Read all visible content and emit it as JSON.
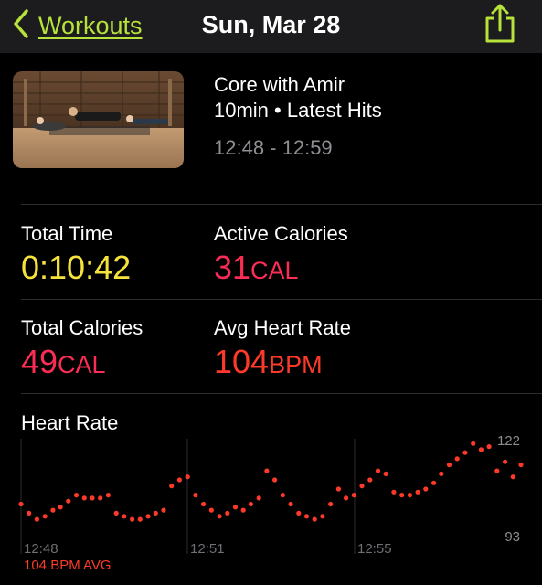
{
  "nav": {
    "back_label": "Workouts",
    "title": "Sun, Mar 28"
  },
  "workout": {
    "title": "Core with Amir",
    "subtitle": "10min • Latest Hits",
    "time_range": "12:48 - 12:59"
  },
  "metrics": {
    "total_time": {
      "label": "Total Time",
      "value": "0:10:42"
    },
    "active_calories": {
      "label": "Active Calories",
      "value": "31",
      "unit": "CAL"
    },
    "total_calories": {
      "label": "Total Calories",
      "value": "49",
      "unit": "CAL"
    },
    "avg_heart_rate": {
      "label": "Avg Heart Rate",
      "value": "104",
      "unit": "BPM"
    }
  },
  "heart_rate": {
    "title": "Heart Rate",
    "avg_label": "104 BPM AVG"
  },
  "colors": {
    "accent_green": "#b6e23a",
    "yellow": "#f5e23b",
    "pink": "#fa2d55",
    "heart_red": "#fd3a2a",
    "secondary_text": "#8e8e93"
  },
  "chart_data": {
    "type": "scatter",
    "title": "Heart Rate",
    "x_ticks": [
      "12:48",
      "12:51",
      "12:55"
    ],
    "y_max_label": "122",
    "y_min_label": "93",
    "ylim": [
      93,
      122
    ],
    "x_unit": "minutes after 12:48",
    "grid": "vertical",
    "x": [
      0.0,
      0.17,
      0.34,
      0.51,
      0.68,
      0.84,
      1.01,
      1.18,
      1.35,
      1.52,
      1.69,
      1.86,
      2.03,
      2.2,
      2.37,
      2.54,
      2.71,
      2.87,
      3.04,
      3.21,
      3.38,
      3.55,
      3.72,
      3.89,
      4.06,
      4.23,
      4.4,
      4.57,
      4.74,
      4.9,
      5.07,
      5.24,
      5.41,
      5.58,
      5.75,
      5.92,
      6.09,
      6.26,
      6.43,
      6.6,
      6.77,
      6.93,
      7.1,
      7.27,
      7.44,
      7.61,
      7.78,
      7.95,
      8.12,
      8.29,
      8.46,
      8.63,
      8.8,
      8.96,
      9.13,
      9.3,
      9.47,
      9.64,
      9.81,
      9.98,
      10.15,
      10.32,
      10.49,
      10.66
    ],
    "values": [
      101,
      98,
      96,
      97,
      99,
      100,
      102,
      104,
      103,
      103,
      103,
      104,
      98,
      97,
      96,
      96,
      97,
      98,
      99,
      107,
      109,
      110,
      104,
      101,
      99,
      97,
      98,
      100,
      99,
      101,
      103,
      112,
      109,
      104,
      101,
      98,
      97,
      96,
      97,
      101,
      106,
      103,
      104,
      107,
      109,
      112,
      111,
      105,
      104,
      104,
      105,
      106,
      108,
      111,
      114,
      116,
      118,
      121,
      119,
      120,
      112,
      115,
      110,
      114
    ]
  }
}
